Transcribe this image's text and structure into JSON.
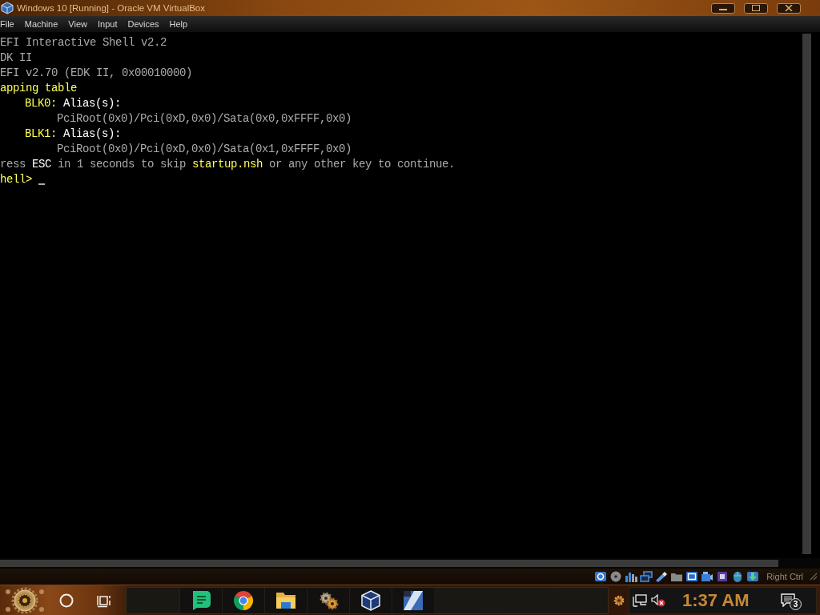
{
  "window": {
    "title": "Windows 10 [Running] - Oracle VM VirtualBox"
  },
  "menu": [
    "File",
    "Machine",
    "View",
    "Input",
    "Devices",
    "Help"
  ],
  "terminal": {
    "lines": [
      {
        "segments": [
          {
            "text": "EFI Interactive Shell v2.2",
            "color": "#aaaaaa"
          }
        ]
      },
      {
        "segments": [
          {
            "text": "DK II",
            "color": "#aaaaaa"
          }
        ]
      },
      {
        "segments": [
          {
            "text": "EFI v2.70 (EDK II, 0x00010000)",
            "color": "#aaaaaa"
          }
        ]
      },
      {
        "segments": [
          {
            "text": "apping table",
            "color": "#ffff55"
          }
        ],
        "children": [
          {
            "segments": [
              {
                "text": "BLK0:",
                "color": "#ffff55"
              },
              {
                "text": " Alias(s):",
                "color": "#ffffff"
              }
            ],
            "children": [
              {
                "segments": [
                  {
                    "text": "PciRoot(0x0)/Pci(0xD,0x0)/Sata(0x0,0xFFFF,0x0)",
                    "color": "#aaaaaa"
                  }
                ]
              }
            ]
          },
          {
            "segments": [
              {
                "text": "BLK1:",
                "color": "#ffff55"
              },
              {
                "text": " Alias(s):",
                "color": "#ffffff"
              }
            ],
            "children": [
              {
                "segments": [
                  {
                    "text": "PciRoot(0x0)/Pci(0xD,0x0)/Sata(0x1,0xFFFF,0x0)",
                    "color": "#aaaaaa"
                  }
                ]
              }
            ]
          }
        ]
      },
      {
        "segments": [
          {
            "text": "ress ",
            "color": "#aaaaaa"
          },
          {
            "text": "ESC",
            "color": "#ffffff"
          },
          {
            "text": " in 1 seconds to skip ",
            "color": "#aaaaaa"
          },
          {
            "text": "startup.nsh",
            "color": "#ffff55"
          },
          {
            "text": " or any other key to continue.",
            "color": "#aaaaaa"
          }
        ]
      }
    ],
    "prompt": {
      "segments": [
        {
          "text": "hell>",
          "color": "#ffff55"
        }
      ],
      "cursor": true
    }
  },
  "status_bar": {
    "host_key": "Right Ctrl"
  },
  "taskbar": {
    "clock": "1:37 AM",
    "notification_count": "3"
  }
}
